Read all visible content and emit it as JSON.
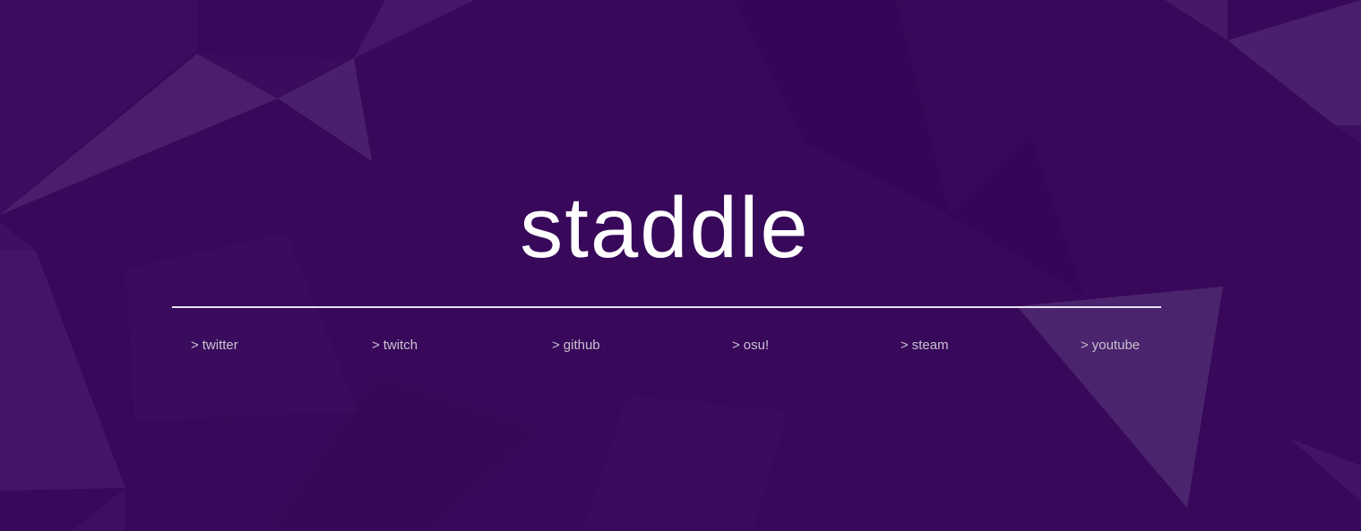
{
  "hero": {
    "title": "staddle"
  },
  "links": [
    {
      "prefix": ">",
      "label": "twitter"
    },
    {
      "prefix": ">",
      "label": "twitch"
    },
    {
      "prefix": ">",
      "label": "github"
    },
    {
      "prefix": ">",
      "label": "osu!"
    },
    {
      "prefix": ">",
      "label": "steam"
    },
    {
      "prefix": ">",
      "label": "youtube"
    }
  ],
  "colors": {
    "background": "#38085a",
    "title": "#ffffff",
    "link": "#c9c2d2",
    "divider": "#e8e2ee"
  }
}
